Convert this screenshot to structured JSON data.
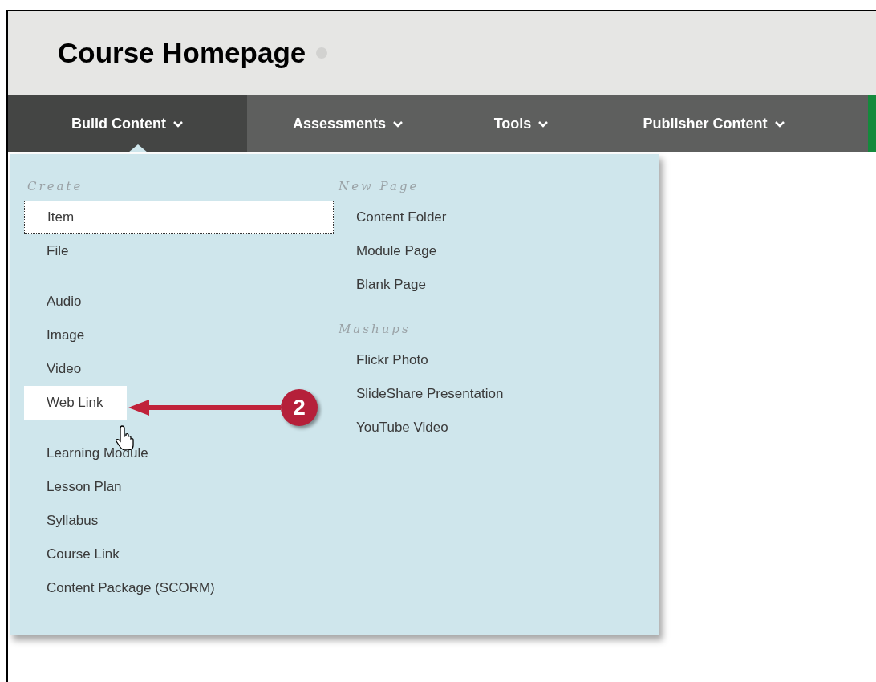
{
  "page": {
    "title": "Course Homepage"
  },
  "nav_tabs": [
    {
      "label": "Build Content",
      "selected": true
    },
    {
      "label": "Assessments",
      "selected": false
    },
    {
      "label": "Tools",
      "selected": false
    },
    {
      "label": "Publisher Content",
      "selected": false
    }
  ],
  "menu": {
    "columns": [
      {
        "sections": [
          {
            "heading": "Create",
            "groups": [
              [
                {
                  "label": "Item",
                  "focused": true,
                  "hovered": false
                },
                {
                  "label": "File",
                  "focused": false,
                  "hovered": false
                }
              ],
              [
                {
                  "label": "Audio",
                  "focused": false,
                  "hovered": false
                },
                {
                  "label": "Image",
                  "focused": false,
                  "hovered": false
                },
                {
                  "label": "Video",
                  "focused": false,
                  "hovered": false
                },
                {
                  "label": "Web Link",
                  "focused": false,
                  "hovered": true
                }
              ],
              [
                {
                  "label": "Learning Module",
                  "focused": false,
                  "hovered": false
                },
                {
                  "label": "Lesson Plan",
                  "focused": false,
                  "hovered": false
                },
                {
                  "label": "Syllabus",
                  "focused": false,
                  "hovered": false
                },
                {
                  "label": "Course Link",
                  "focused": false,
                  "hovered": false
                },
                {
                  "label": "Content Package (SCORM)",
                  "focused": false,
                  "hovered": false
                }
              ]
            ]
          }
        ]
      },
      {
        "sections": [
          {
            "heading": "New Page",
            "groups": [
              [
                {
                  "label": "Content Folder",
                  "focused": false,
                  "hovered": false
                },
                {
                  "label": "Module Page",
                  "focused": false,
                  "hovered": false
                },
                {
                  "label": "Blank Page",
                  "focused": false,
                  "hovered": false
                }
              ]
            ]
          },
          {
            "heading": "Mashups",
            "groups": [
              [
                {
                  "label": "Flickr Photo",
                  "focused": false,
                  "hovered": false
                },
                {
                  "label": "SlideShare Presentation",
                  "focused": false,
                  "hovered": false
                },
                {
                  "label": "YouTube Video",
                  "focused": false,
                  "hovered": false
                }
              ]
            ]
          }
        ]
      }
    ]
  },
  "callout": {
    "label": "2"
  }
}
